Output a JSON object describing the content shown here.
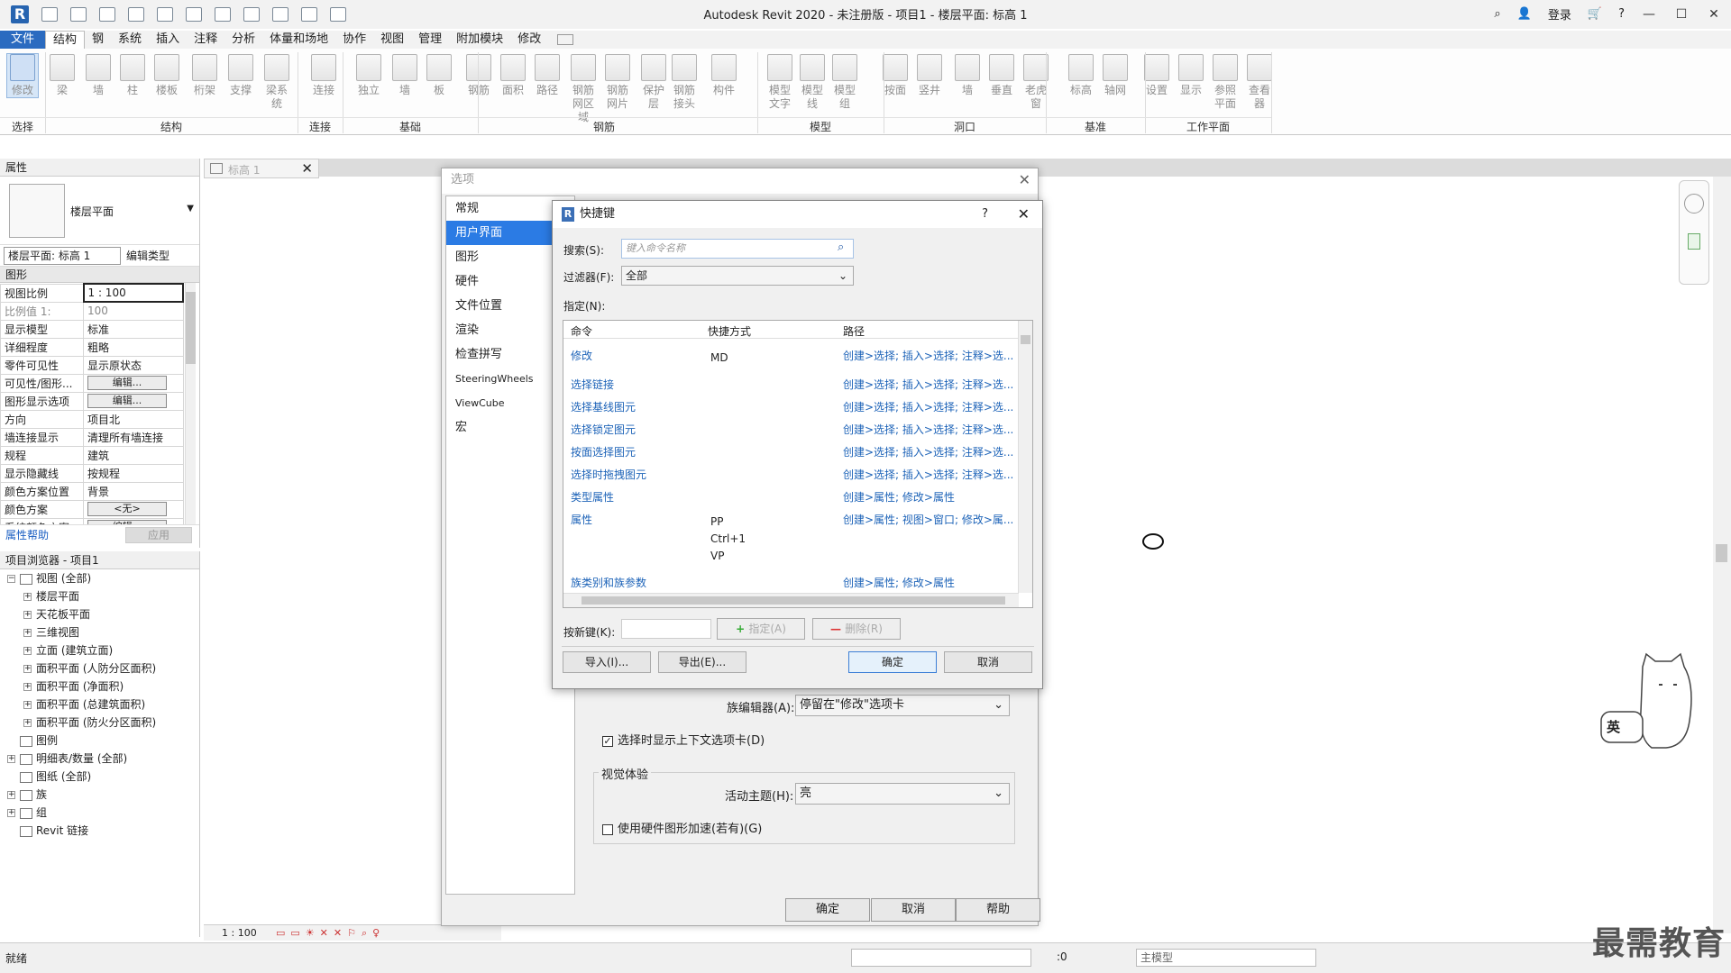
{
  "window": {
    "title": "Autodesk Revit 2020 - 未注册版 - 项目1 - 楼层平面: 标高 1",
    "login": "登录"
  },
  "tabs": [
    "文件",
    "结构",
    "钢",
    "系统",
    "插入",
    "注释",
    "分析",
    "体量和场地",
    "协作",
    "视图",
    "管理",
    "附加模块",
    "修改"
  ],
  "active_tab": "结构",
  "ribbon": {
    "buttons": [
      "修改",
      "梁",
      "墙",
      "柱",
      "楼板",
      "桁架",
      "支撑",
      "梁系统",
      "连接",
      "独立",
      "墙",
      "板",
      "钢筋",
      "面积",
      "路径",
      "钢筋网区域",
      "钢筋网片",
      "保护层",
      "钢筋接头",
      "构件",
      "模型文字",
      "模型线",
      "模型组",
      "按面",
      "竖井",
      "墙",
      "垂直",
      "老虎窗",
      "标高",
      "轴网",
      "设置",
      "显示",
      "参照平面",
      "查看器"
    ],
    "groups": [
      "选择",
      "结构",
      "连接",
      "基础",
      "钢筋",
      "模型",
      "洞口",
      "基准",
      "工作平面"
    ]
  },
  "properties": {
    "header": "属性",
    "type_name": "楼层平面",
    "view_selector": "楼层平面: 标高 1",
    "edit_type": "编辑类型",
    "group": "图形",
    "rows": [
      {
        "k": "视图比例",
        "v": "1 : 100"
      },
      {
        "k": "比例值 1:",
        "v": "100"
      },
      {
        "k": "显示模型",
        "v": "标准"
      },
      {
        "k": "详细程度",
        "v": "粗略"
      },
      {
        "k": "零件可见性",
        "v": "显示原状态"
      },
      {
        "k": "可见性/图形...",
        "v": "编辑..."
      },
      {
        "k": "图形显示选项",
        "v": "编辑..."
      },
      {
        "k": "方向",
        "v": "项目北"
      },
      {
        "k": "墙连接显示",
        "v": "清理所有墙连接"
      },
      {
        "k": "规程",
        "v": "建筑"
      },
      {
        "k": "显示隐藏线",
        "v": "按规程"
      },
      {
        "k": "颜色方案位置",
        "v": "背景"
      },
      {
        "k": "颜色方案",
        "v": "<无>"
      },
      {
        "k": "系统颜色方案",
        "v": "编辑..."
      }
    ],
    "help_link": "属性帮助",
    "apply": "应用"
  },
  "browser": {
    "header": "项目浏览器 - 项目1",
    "items": [
      {
        "label": "视图 (全部)",
        "level": 0,
        "exp": "−"
      },
      {
        "label": "楼层平面",
        "level": 1,
        "exp": "+"
      },
      {
        "label": "天花板平面",
        "level": 1,
        "exp": "+"
      },
      {
        "label": "三维视图",
        "level": 1,
        "exp": "+"
      },
      {
        "label": "立面 (建筑立面)",
        "level": 1,
        "exp": "+"
      },
      {
        "label": "面积平面 (人防分区面积)",
        "level": 1,
        "exp": "+"
      },
      {
        "label": "面积平面 (净面积)",
        "level": 1,
        "exp": "+"
      },
      {
        "label": "面积平面 (总建筑面积)",
        "level": 1,
        "exp": "+"
      },
      {
        "label": "面积平面 (防火分区面积)",
        "level": 1,
        "exp": "+"
      },
      {
        "label": "图例",
        "level": 0,
        "exp": ""
      },
      {
        "label": "明细表/数量 (全部)",
        "level": 0,
        "exp": "+"
      },
      {
        "label": "图纸 (全部)",
        "level": 0,
        "exp": ""
      },
      {
        "label": "族",
        "level": 0,
        "exp": "+"
      },
      {
        "label": "组",
        "level": 0,
        "exp": "+"
      },
      {
        "label": "Revit 链接",
        "level": 0,
        "exp": ""
      }
    ]
  },
  "view_tab": "标高 1",
  "view_scale": "1 : 100",
  "status": {
    "ready": "就绪",
    "zero": ":0",
    "model": "主模型"
  },
  "options_dialog": {
    "title": "选项",
    "nav": [
      "常规",
      "用户界面",
      "图形",
      "硬件",
      "文件位置",
      "渲染",
      "检查拼写",
      "SteeringWheels",
      "ViewCube",
      "宏"
    ],
    "active_nav": "用户界面",
    "family_editor_label": "族编辑器(A):",
    "family_editor_value": "停留在\"修改\"选项卡",
    "show_context_tab": "选择时显示上下文选项卡(D)",
    "visual_group": "视觉体验",
    "theme_label": "活动主题(H):",
    "theme_value": "亮",
    "hw_accel": "使用硬件图形加速(若有)(G)",
    "ok": "确定",
    "cancel": "取消",
    "help": "帮助"
  },
  "shortcut_dialog": {
    "title": "快捷键",
    "help_q": "?",
    "search_label": "搜索(S):",
    "search_placeholder": "键入命令名称",
    "filter_label": "过滤器(F):",
    "filter_value": "全部",
    "assign_label": "指定(N):",
    "col_command": "命令",
    "col_shortcut": "快捷方式",
    "col_path": "路径",
    "rows": [
      {
        "cmd": "修改",
        "keys": "MD",
        "path": "创建>选择; 插入>选择; 注释>选..."
      },
      {
        "cmd": "选择链接",
        "keys": "",
        "path": "创建>选择; 插入>选择; 注释>选..."
      },
      {
        "cmd": "选择基线图元",
        "keys": "",
        "path": "创建>选择; 插入>选择; 注释>选..."
      },
      {
        "cmd": "选择锁定图元",
        "keys": "",
        "path": "创建>选择; 插入>选择; 注释>选..."
      },
      {
        "cmd": "按面选择图元",
        "keys": "",
        "path": "创建>选择; 插入>选择; 注释>选..."
      },
      {
        "cmd": "选择时拖拽图元",
        "keys": "",
        "path": "创建>选择; 插入>选择; 注释>选..."
      },
      {
        "cmd": "类型属性",
        "keys": "",
        "path": "创建>属性; 修改>属性"
      },
      {
        "cmd": "属性",
        "keys": "PP\nCtrl+1\nVP",
        "path": "创建>属性; 视图>窗口; 修改>属..."
      },
      {
        "cmd": "族类别和族参数",
        "keys": "",
        "path": "创建>属性; 修改>属性"
      }
    ],
    "new_key_label": "按新键(K):",
    "assign_btn": "指定(A)",
    "delete_btn": "删除(R)",
    "import_btn": "导入(I)...",
    "export_btn": "导出(E)...",
    "ok": "确定",
    "cancel": "取消"
  },
  "watermark": "最需教育",
  "ime_label": "英"
}
